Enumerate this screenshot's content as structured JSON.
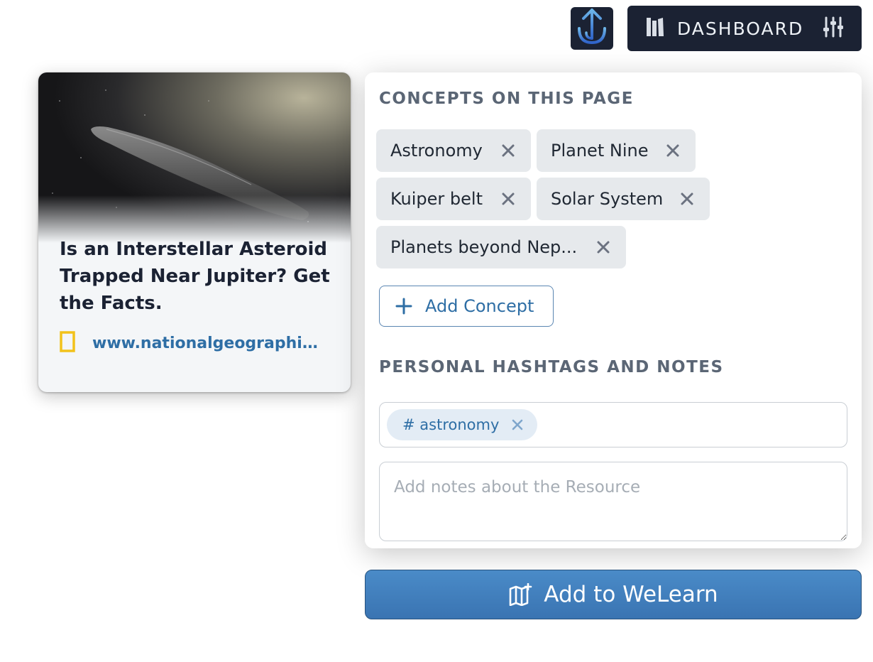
{
  "header": {
    "logo_icon": "anchor-icon",
    "dashboard_label": "DASHBOARD",
    "dashboard_icon": "bookshelf-icon",
    "settings_icon": "sliders-icon"
  },
  "resource": {
    "title": "Is an Interstellar Asteroid Trapped Near Jupiter? Get the Facts.",
    "source_url": "www.nationalgeographic.com",
    "source_icon": "national-geographic-icon"
  },
  "concepts": {
    "heading": "CONCEPTS ON THIS PAGE",
    "items": [
      {
        "label": "Astronomy"
      },
      {
        "label": "Planet Nine"
      },
      {
        "label": "Kuiper belt"
      },
      {
        "label": "Solar System"
      },
      {
        "label": "Planets beyond Nep..."
      }
    ],
    "add_label": "Add Concept"
  },
  "personal": {
    "heading": "PERSONAL HASHTAGS AND NOTES",
    "hashtags": [
      {
        "label": "# astronomy"
      }
    ],
    "notes_placeholder": "Add notes about the Resource",
    "notes_value": ""
  },
  "actions": {
    "add_to_welearn_label": "Add to WeLearn"
  },
  "colors": {
    "dark_navy": "#1b2233",
    "accent_blue": "#2e6ea5",
    "primary_button": "#3f7fbf",
    "chip_bg": "#e6e9ec"
  }
}
